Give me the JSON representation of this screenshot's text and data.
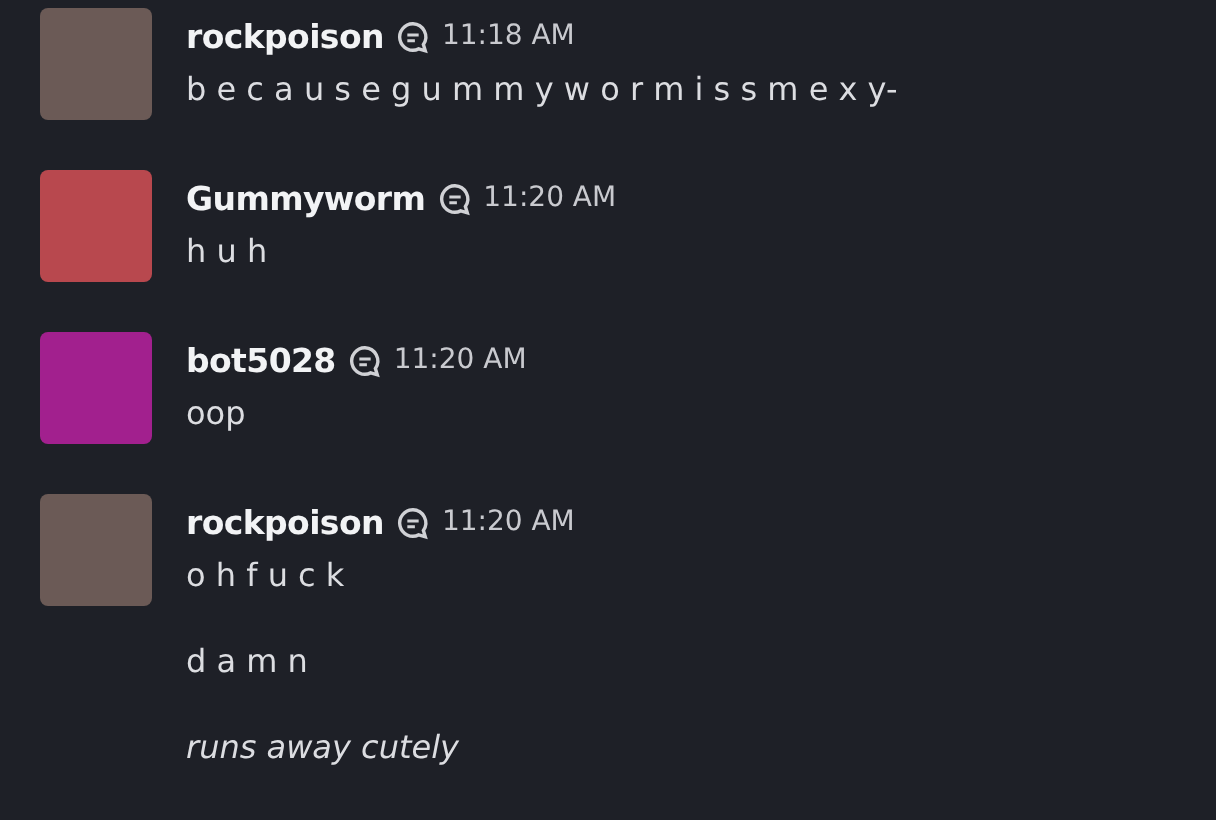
{
  "messages": [
    {
      "author": "rockpoison",
      "color": "#6b5a56",
      "time": "11:18 AM",
      "lines": [
        {
          "text": "b e c a u s e g u m m y w o r m i s s m e x y-",
          "italic": false
        }
      ]
    },
    {
      "author": "Gummyworm",
      "color": "#b8484e",
      "time": "11:20 AM",
      "lines": [
        {
          "text": "h u h",
          "italic": false
        }
      ]
    },
    {
      "author": "bot5028",
      "color": "#a2208e",
      "time": "11:20 AM",
      "lines": [
        {
          "text": "oop",
          "italic": false
        }
      ]
    },
    {
      "author": "rockpoison",
      "color": "#6b5a56",
      "time": "11:20 AM",
      "lines": [
        {
          "text": "o h f u c k",
          "italic": false
        },
        {
          "text": "d a m n",
          "italic": false
        },
        {
          "text": "runs away cutely",
          "italic": true
        }
      ]
    }
  ]
}
